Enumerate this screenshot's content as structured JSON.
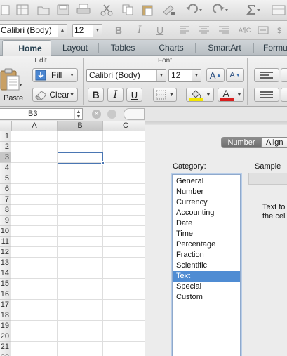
{
  "format_bar": {
    "font_name": "Calibri (Body)",
    "font_size": "12",
    "bold_glyph": "B",
    "italic_glyph": "I",
    "underline_glyph": "U",
    "abc_glyph": "A¶C"
  },
  "ribbon_tabs": [
    {
      "label": "Home",
      "active": true
    },
    {
      "label": "Layout",
      "active": false
    },
    {
      "label": "Tables",
      "active": false
    },
    {
      "label": "Charts",
      "active": false
    },
    {
      "label": "SmartArt",
      "active": false
    },
    {
      "label": "Formu",
      "active": false
    }
  ],
  "ribbon": {
    "edit_group": {
      "title": "Edit",
      "paste_label": "Paste",
      "fill_label": "Fill",
      "clear_label": "Clear"
    },
    "font_group": {
      "title": "Font",
      "font_name": "Calibri (Body)",
      "font_size": "12",
      "bold_glyph": "B",
      "italic_glyph": "I",
      "underline_glyph": "U",
      "grow_glyph": "A",
      "shrink_glyph": "A",
      "font_color_glyph": "A",
      "highlight_color": "#f3e600",
      "font_color": "#d81e1e"
    }
  },
  "formula_bar": {
    "name_box": "B3",
    "cancel_glyph": "✕"
  },
  "sheet": {
    "columns": [
      "A",
      "B",
      "C"
    ],
    "selected_column": "B",
    "rows": [
      "1",
      "2",
      "3",
      "4",
      "5",
      "6",
      "7",
      "8",
      "9",
      "10",
      "11",
      "12",
      "13",
      "14",
      "15",
      "16",
      "17",
      "18",
      "19",
      "20",
      "21",
      "22"
    ],
    "selected_row": "3"
  },
  "dialog": {
    "tabs": [
      {
        "label": "Number",
        "active": true
      },
      {
        "label": "Align",
        "active": false
      }
    ],
    "category_label": "Category:",
    "sample_label": "Sample",
    "categories": [
      "General",
      "Number",
      "Currency",
      "Accounting",
      "Date",
      "Time",
      "Percentage",
      "Fraction",
      "Scientific",
      "Text",
      "Special",
      "Custom"
    ],
    "selected_category": "Text",
    "description_line1": "Text fo",
    "description_line2": "the cel"
  }
}
